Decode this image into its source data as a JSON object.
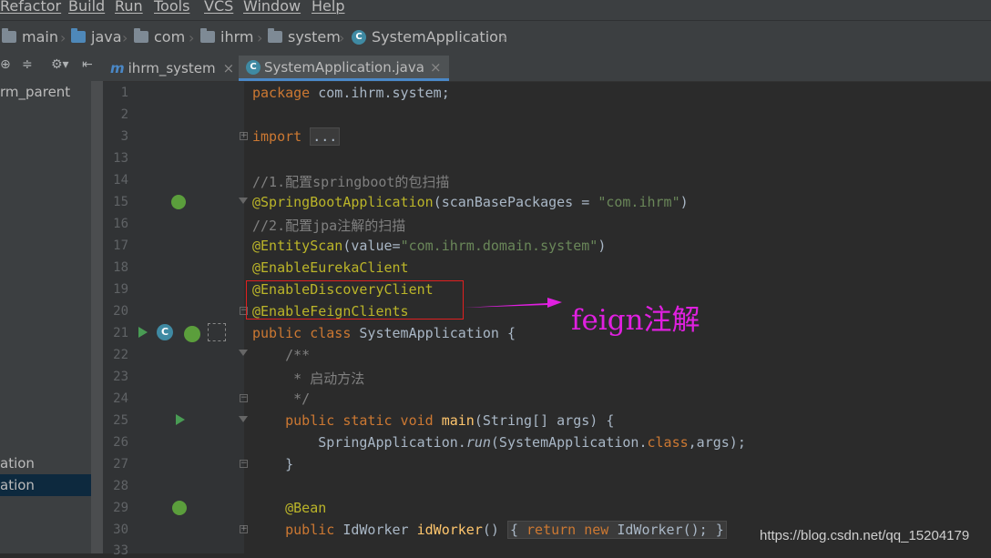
{
  "menu": [
    "Refactor",
    "Build",
    "Run",
    "Tools",
    "VCS",
    "Window",
    "Help"
  ],
  "breadcrumb": [
    "main",
    "java",
    "com",
    "ihrm",
    "system",
    "SystemApplication"
  ],
  "tabs": [
    {
      "label": "ihrm_system",
      "icon": "m"
    },
    {
      "label": "SystemApplication.java",
      "icon": "c",
      "active": true
    }
  ],
  "sidebar": {
    "items": [
      "rm_parent",
      "ation",
      "ation"
    ]
  },
  "lines": [
    {
      "num": "1"
    },
    {
      "num": "2"
    },
    {
      "num": "3"
    },
    {
      "num": "13"
    },
    {
      "num": "14"
    },
    {
      "num": "15"
    },
    {
      "num": "16"
    },
    {
      "num": "17"
    },
    {
      "num": "18"
    },
    {
      "num": "19"
    },
    {
      "num": "20"
    },
    {
      "num": "21"
    },
    {
      "num": "22"
    },
    {
      "num": "23"
    },
    {
      "num": "24"
    },
    {
      "num": "25"
    },
    {
      "num": "26"
    },
    {
      "num": "27"
    },
    {
      "num": "28"
    },
    {
      "num": "29"
    },
    {
      "num": "30"
    },
    {
      "num": "33"
    }
  ],
  "code": {
    "l1_kw": "package",
    "l1_rest": " com.ihrm.system;",
    "l3_kw": "import",
    "l3_fold": "...",
    "l14": "//1.配置springboot的包扫描",
    "l15_ann": "@SpringBootApplication",
    "l15_a": "(scanBasePackages = ",
    "l15_str": "\"com.ihrm\"",
    "l15_b": ")",
    "l16": "//2.配置jpa注解的扫描",
    "l17_ann": "@EntityScan",
    "l17_a": "(value=",
    "l17_str": "\"com.ihrm.domain.system\"",
    "l17_b": ")",
    "l18": "@EnableEurekaClient",
    "l19": "@EnableDiscoveryClient",
    "l20": "@EnableFeignClients",
    "l21_kw": "public class ",
    "l21_rest": "SystemApplication {",
    "l22": "    /**",
    "l23": "     * 启动方法",
    "l24": "     */",
    "l25_kw": "    public static void ",
    "l25_fn": "main",
    "l25_rest": "(String[] args) {",
    "l26_a": "        SpringApplication.",
    "l26_it": "run",
    "l26_b": "(SystemApplication.",
    "l26_kw": "class",
    "l26_c": ",args);",
    "l27": "    }",
    "l29": "    @Bean",
    "l30_kw": "    public ",
    "l30_a": "IdWorker ",
    "l30_fn": "idWorker",
    "l30_b": "() ",
    "l30_fold": "{ ",
    "l30_kw2": "return new ",
    "l30_c": "IdWorker(); ",
    "l30_d": "}"
  },
  "callout": "feign注解",
  "watermark": "https://blog.csdn.net/qq_15204179",
  "colors": {
    "keyword": "#cc7832",
    "annotation": "#bbb529",
    "string": "#6a8759",
    "comment": "#808080",
    "highlight": "#e02020",
    "callout": "#e020e0"
  }
}
